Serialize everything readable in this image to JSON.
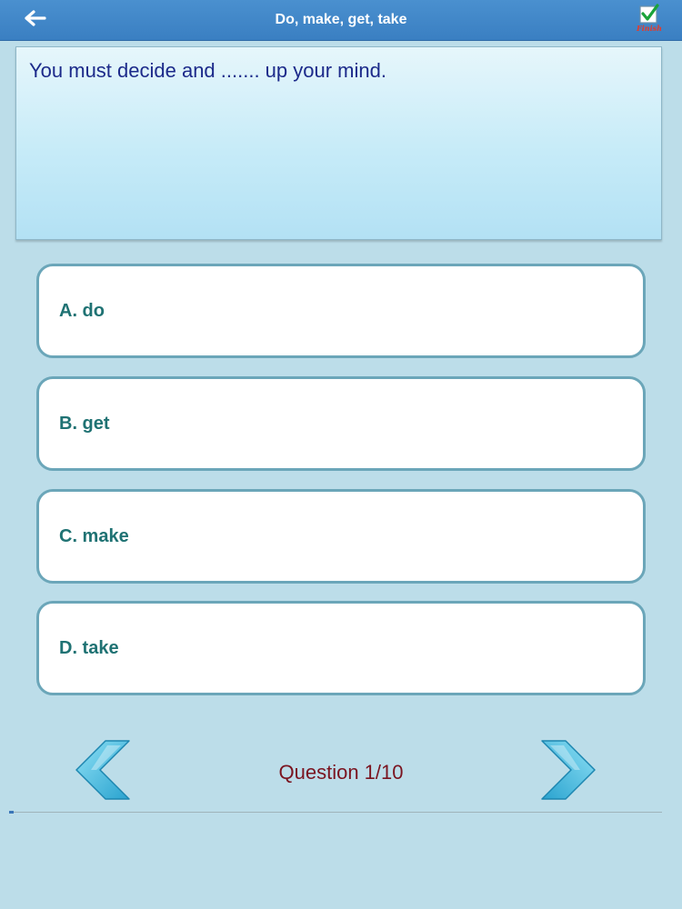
{
  "header": {
    "title": "Do, make, get, take",
    "back_icon": "arrow-left-icon",
    "finish_icon": "checkmark-icon",
    "finish_label": "Finish"
  },
  "question": {
    "text": "You must decide and ....... up your mind."
  },
  "options": [
    {
      "label": "A. do"
    },
    {
      "label": "B. get"
    },
    {
      "label": "C. make"
    },
    {
      "label": "D. take"
    }
  ],
  "navigation": {
    "counter": "Question 1/10",
    "prev_icon": "chevron-left-icon",
    "next_icon": "chevron-right-icon"
  },
  "colors": {
    "header_bg": "#3a7fc2",
    "background": "#bcdde9",
    "question_text": "#1c2a8a",
    "option_text": "#1f7273",
    "option_border": "#6ba6b9",
    "counter_text": "#7a1420",
    "finish_label": "#e53a2a"
  }
}
